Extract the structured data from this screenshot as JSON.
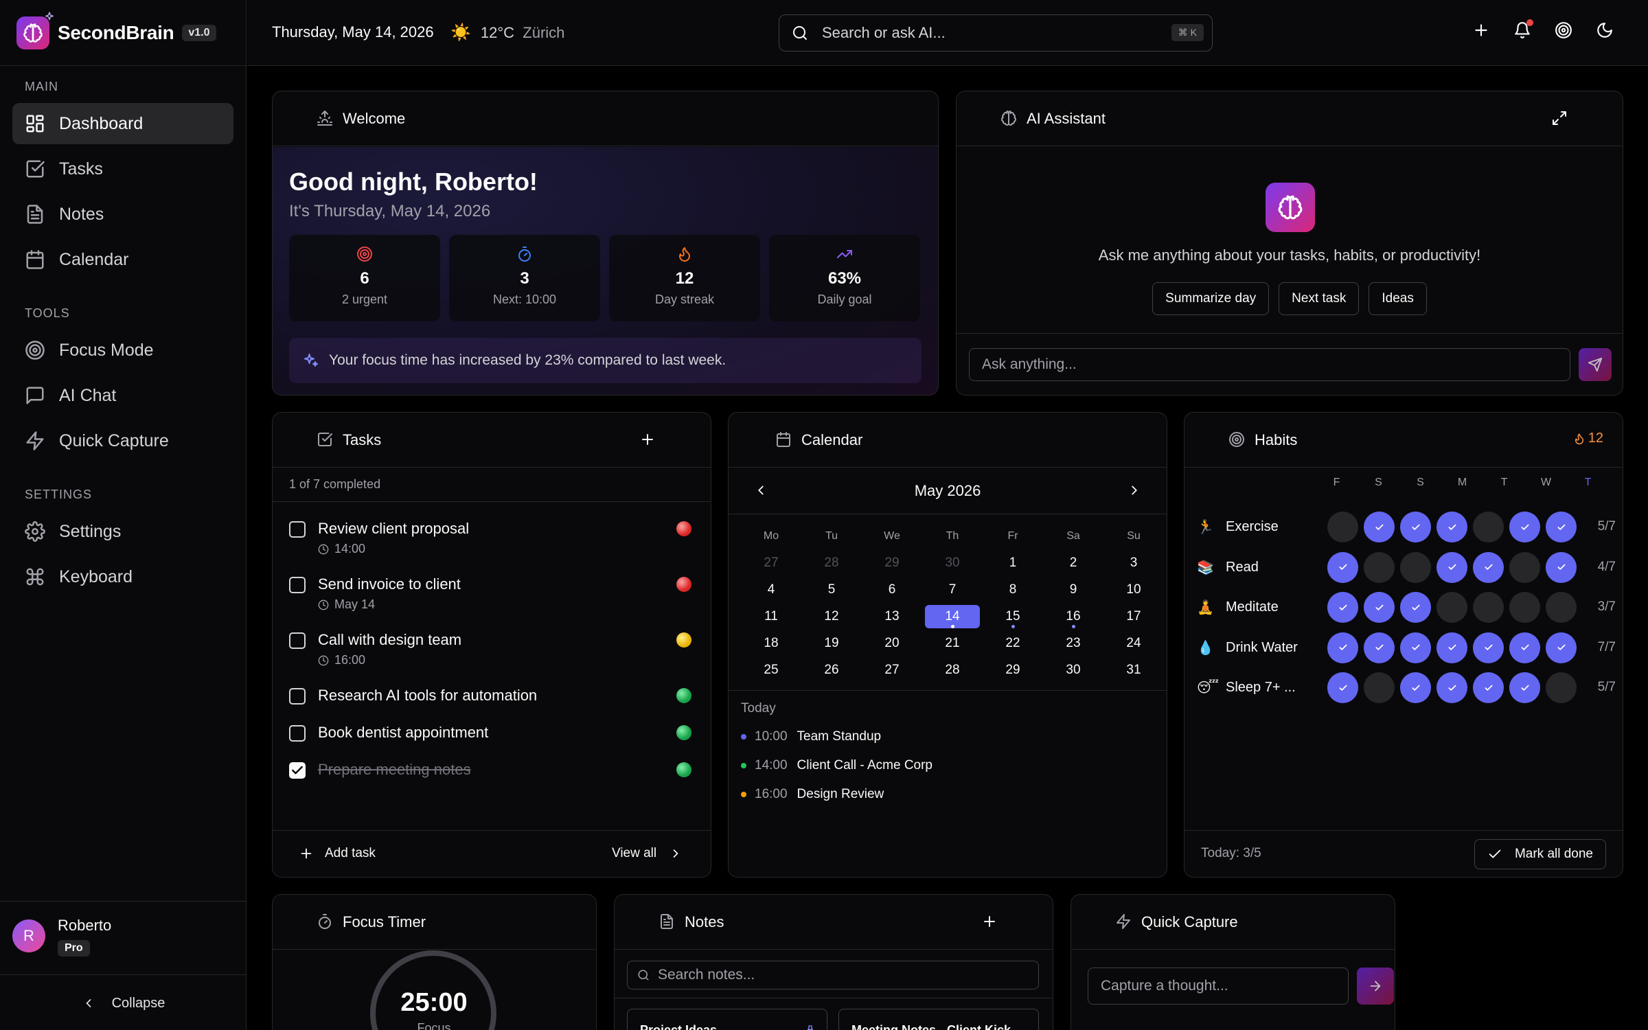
{
  "brand": {
    "name": "SecondBrain",
    "version": "v1.0"
  },
  "sidebar": {
    "sections": {
      "main": "MAIN",
      "tools": "TOOLS",
      "settings": "SETTINGS"
    },
    "items": [
      {
        "label": "Dashboard",
        "icon": "dashboard-icon",
        "active": true
      },
      {
        "label": "Tasks",
        "icon": "check-square-icon"
      },
      {
        "label": "Notes",
        "icon": "file-text-icon"
      },
      {
        "label": "Calendar",
        "icon": "calendar-icon"
      },
      {
        "label": "Focus Mode",
        "icon": "target-icon"
      },
      {
        "label": "AI Chat",
        "icon": "message-icon"
      },
      {
        "label": "Quick Capture",
        "icon": "zap-icon"
      },
      {
        "label": "Settings",
        "icon": "gear-icon"
      },
      {
        "label": "Keyboard",
        "icon": "command-icon"
      }
    ],
    "user": {
      "initial": "R",
      "name": "Roberto",
      "plan": "Pro"
    },
    "collapse_label": "Collapse"
  },
  "header": {
    "date": "Thursday, May 14, 2026",
    "weather": {
      "icon": "☀️",
      "temp": "12°C",
      "city": "Zürich"
    },
    "search": {
      "placeholder": "Search or ask AI...",
      "shortcut": "⌘ K"
    }
  },
  "welcome": {
    "title": "Welcome",
    "greeting": "Good night, Roberto!",
    "subtitle": "It's Thursday, May 14, 2026",
    "stats": [
      {
        "value": "6",
        "label": "2 urgent",
        "icon": "target-icon",
        "color": "#ef4444"
      },
      {
        "value": "3",
        "label": "Next: 10:00",
        "icon": "timer-icon",
        "color": "#3b82f6"
      },
      {
        "value": "12",
        "label": "Day streak",
        "icon": "flame-icon",
        "color": "#f97316"
      },
      {
        "value": "63%",
        "label": "Daily goal",
        "icon": "trending-up-icon",
        "color": "#8b5cf6"
      }
    ],
    "insight": "Your focus time has increased by 23% compared to last week."
  },
  "ai": {
    "title": "AI Assistant",
    "message": "Ask me anything about your tasks, habits, or productivity!",
    "chips": [
      "Summarize day",
      "Next task",
      "Ideas"
    ],
    "placeholder": "Ask anything..."
  },
  "tasks": {
    "title": "Tasks",
    "summary": "1 of 7 completed",
    "items": [
      {
        "title": "Review client proposal",
        "meta": "14:00",
        "priority": "#ef4444",
        "done": false
      },
      {
        "title": "Send invoice to client",
        "meta": "May 14",
        "priority": "#ef4444",
        "done": false
      },
      {
        "title": "Call with design team",
        "meta": "16:00",
        "priority": "#facc15",
        "done": false
      },
      {
        "title": "Research AI tools for automation",
        "meta": "",
        "priority": "#22c55e",
        "done": false
      },
      {
        "title": "Book dentist appointment",
        "meta": "",
        "priority": "#22c55e",
        "done": false
      },
      {
        "title": "Prepare meeting notes",
        "meta": "",
        "priority": "#22c55e",
        "done": true
      }
    ],
    "add_label": "Add task",
    "view_all_label": "View all"
  },
  "calendar": {
    "title": "Calendar",
    "month": "May 2026",
    "weekdays": [
      "Mo",
      "Tu",
      "We",
      "Th",
      "Fr",
      "Sa",
      "Su"
    ],
    "weeks": [
      [
        "27",
        "28",
        "29",
        "30",
        "1",
        "2",
        "3"
      ],
      [
        "4",
        "5",
        "6",
        "7",
        "8",
        "9",
        "10"
      ],
      [
        "11",
        "12",
        "13",
        "14",
        "15",
        "16",
        "17"
      ],
      [
        "18",
        "19",
        "20",
        "21",
        "22",
        "23",
        "24"
      ],
      [
        "25",
        "26",
        "27",
        "28",
        "29",
        "30",
        "31"
      ]
    ],
    "today": "14",
    "event_days": [
      "14",
      "15",
      "16"
    ],
    "today_label": "Today",
    "events": [
      {
        "time": "10:00",
        "title": "Team Standup",
        "color": "#6366f1"
      },
      {
        "time": "14:00",
        "title": "Client Call - Acme Corp",
        "color": "#22c55e"
      },
      {
        "time": "16:00",
        "title": "Design Review",
        "color": "#f59e0b"
      }
    ]
  },
  "habits": {
    "title": "Habits",
    "streak": "12",
    "days": [
      "F",
      "S",
      "S",
      "M",
      "T",
      "W",
      "T"
    ],
    "items": [
      {
        "emoji": "🏃",
        "name": "Exercise",
        "done": [
          0,
          1,
          1,
          1,
          0,
          1,
          1
        ],
        "count": "5/7"
      },
      {
        "emoji": "📚",
        "name": "Read",
        "done": [
          1,
          0,
          0,
          1,
          1,
          0,
          1
        ],
        "count": "4/7"
      },
      {
        "emoji": "🧘",
        "name": "Meditate",
        "done": [
          1,
          1,
          1,
          0,
          0,
          0,
          0
        ],
        "count": "3/7"
      },
      {
        "emoji": "💧",
        "name": "Drink Water",
        "done": [
          1,
          1,
          1,
          1,
          1,
          1,
          1
        ],
        "count": "7/7"
      },
      {
        "emoji": "😴",
        "name": "Sleep 7+ ...",
        "done": [
          1,
          0,
          1,
          1,
          1,
          1,
          0
        ],
        "count": "5/7"
      }
    ],
    "today_summary": "Today: 3/5",
    "mark_all_label": "Mark all done"
  },
  "focus": {
    "title": "Focus Timer",
    "time": "25:00",
    "label": "Focus"
  },
  "notes": {
    "title": "Notes",
    "search_placeholder": "Search notes...",
    "cards": [
      "Project Ideas",
      "Meeting Notes - Client Kick..."
    ]
  },
  "quick_capture": {
    "title": "Quick Capture",
    "placeholder": "Capture a thought..."
  }
}
